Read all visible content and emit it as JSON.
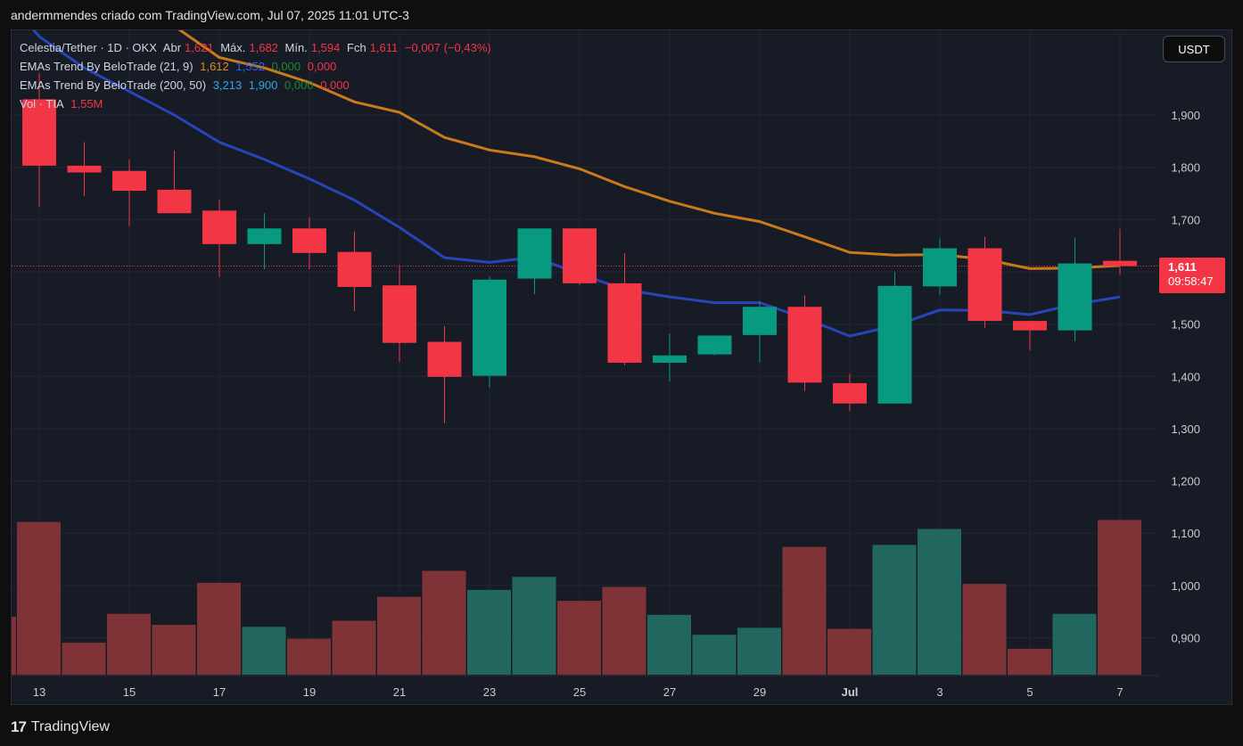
{
  "header": {
    "caption": "andermmendes criado com TradingView.com, Jul 07, 2025 11:01 UTC-3"
  },
  "legend": {
    "symbol": "Celestia/Tether · 1D · OKX",
    "open_label": "Abr",
    "open_value": "1,621",
    "high_label": "Máx.",
    "high_value": "1,682",
    "low_label": "Mín.",
    "low_value": "1,594",
    "close_label": "Fch",
    "close_value": "1,611",
    "change": "−0,007 (−0,43%)",
    "ema1_name": "EMAs Trend By BeloTrade (21, 9)",
    "ema1_v1": "1,612",
    "ema1_v2": "1,552",
    "ema1_v3": "0,000",
    "ema1_v4": "0,000",
    "ema2_name": "EMAs Trend By BeloTrade (200, 50)",
    "ema2_v1": "3,213",
    "ema2_v2": "1,900",
    "ema2_v3": "0,000",
    "ema2_v4": "0,000",
    "vol_name": "Vol · TIA",
    "vol_value": "1,55M"
  },
  "currency_button": "USDT",
  "last_price": {
    "price": "1,611",
    "countdown": "09:58:47"
  },
  "footer": {
    "brand": "TradingView",
    "mark": "17"
  },
  "colors": {
    "up": "#089981",
    "down": "#f23645",
    "vol_up": "#22675f",
    "vol_down": "#7f3337",
    "ema_orange": "#c97a1a",
    "ema_blue": "#2745b8"
  },
  "chart_data": {
    "type": "candlestick",
    "y_ticks": [
      "1,300",
      "1,400",
      "1,500",
      "1,600",
      "1,700",
      "1,800",
      "1,900",
      "1,000",
      "1,100",
      "1,200"
    ],
    "price_ticks": [
      {
        "label": "1,900",
        "value": 1.9
      },
      {
        "label": "1,800",
        "value": 1.8
      },
      {
        "label": "1,700",
        "value": 1.7
      },
      {
        "label": "1,600",
        "value": 1.6
      },
      {
        "label": "1,500",
        "value": 1.5
      },
      {
        "label": "1,400",
        "value": 1.4
      },
      {
        "label": "1,300",
        "value": 1.3
      },
      {
        "label": "1,200",
        "value": 1.2
      },
      {
        "label": "1,100",
        "value": 1.1
      },
      {
        "label": "1,000",
        "value": 1.0
      },
      {
        "label": "0,900",
        "value": 0.9
      }
    ],
    "x_tick_labels": [
      "13",
      "15",
      "17",
      "19",
      "21",
      "23",
      "25",
      "27",
      "29",
      "Jul",
      "3",
      "5",
      "7"
    ],
    "x_tick_index": [
      0,
      2,
      4,
      6,
      8,
      10,
      12,
      14,
      16,
      18,
      20,
      22,
      24
    ],
    "candles": [
      {
        "o": 1.93,
        "h": 1.98,
        "l": 1.725,
        "c": 1.803
      },
      {
        "o": 1.803,
        "h": 1.848,
        "l": 1.745,
        "c": 1.79
      },
      {
        "o": 1.793,
        "h": 1.815,
        "l": 1.687,
        "c": 1.755
      },
      {
        "o": 1.757,
        "h": 1.832,
        "l": 1.73,
        "c": 1.712
      },
      {
        "o": 1.717,
        "h": 1.738,
        "l": 1.59,
        "c": 1.653
      },
      {
        "o": 1.653,
        "h": 1.712,
        "l": 1.605,
        "c": 1.683
      },
      {
        "o": 1.683,
        "h": 1.705,
        "l": 1.605,
        "c": 1.636
      },
      {
        "o": 1.638,
        "h": 1.677,
        "l": 1.525,
        "c": 1.571
      },
      {
        "o": 1.574,
        "h": 1.613,
        "l": 1.427,
        "c": 1.464
      },
      {
        "o": 1.466,
        "h": 1.496,
        "l": 1.31,
        "c": 1.399
      },
      {
        "o": 1.401,
        "h": 1.591,
        "l": 1.378,
        "c": 1.585
      },
      {
        "o": 1.587,
        "h": 1.682,
        "l": 1.557,
        "c": 1.683
      },
      {
        "o": 1.683,
        "h": 1.682,
        "l": 1.575,
        "c": 1.578
      },
      {
        "o": 1.578,
        "h": 1.635,
        "l": 1.421,
        "c": 1.426
      },
      {
        "o": 1.426,
        "h": 1.482,
        "l": 1.39,
        "c": 1.44
      },
      {
        "o": 1.442,
        "h": 1.478,
        "l": 1.44,
        "c": 1.478
      },
      {
        "o": 1.479,
        "h": 1.544,
        "l": 1.427,
        "c": 1.533
      },
      {
        "o": 1.533,
        "h": 1.555,
        "l": 1.372,
        "c": 1.388
      },
      {
        "o": 1.387,
        "h": 1.405,
        "l": 1.333,
        "c": 1.348
      },
      {
        "o": 1.348,
        "h": 1.6,
        "l": 1.348,
        "c": 1.573
      },
      {
        "o": 1.572,
        "h": 1.664,
        "l": 1.556,
        "c": 1.645
      },
      {
        "o": 1.645,
        "h": 1.667,
        "l": 1.493,
        "c": 1.506
      },
      {
        "o": 1.506,
        "h": 1.502,
        "l": 1.45,
        "c": 1.488
      },
      {
        "o": 1.488,
        "h": 1.665,
        "l": 1.467,
        "c": 1.616
      },
      {
        "o": 1.621,
        "h": 1.682,
        "l": 1.594,
        "c": 1.611
      }
    ],
    "volume_values_m": [
      1.53,
      0.32,
      0.61,
      0.5,
      0.92,
      0.48,
      0.36,
      0.54,
      0.78,
      1.04,
      0.85,
      0.98,
      0.74,
      0.88,
      0.6,
      0.4,
      0.47,
      1.28,
      0.46,
      1.3,
      1.46,
      0.91,
      0.26,
      0.61,
      1.55
    ],
    "volume_up": [
      false,
      false,
      false,
      false,
      false,
      true,
      false,
      false,
      false,
      false,
      true,
      true,
      false,
      false,
      true,
      true,
      true,
      false,
      false,
      true,
      true,
      false,
      false,
      true,
      false
    ],
    "ema_fast_values": [
      2.05,
      1.99,
      1.945,
      1.9,
      1.848,
      1.815,
      1.778,
      1.737,
      1.685,
      1.627,
      1.618,
      1.628,
      1.596,
      1.566,
      1.552,
      1.541,
      1.541,
      1.511,
      1.477,
      1.497,
      1.527,
      1.526,
      1.518,
      1.538,
      1.552
    ],
    "ema_slow_values": [
      2.25,
      2.19,
      2.13,
      2.07,
      2.01,
      1.99,
      1.962,
      1.925,
      1.905,
      1.857,
      1.833,
      1.82,
      1.797,
      1.763,
      1.735,
      1.712,
      1.696,
      1.667,
      1.637,
      1.632,
      1.633,
      1.624,
      1.606,
      1.607,
      1.612
    ],
    "last_price_line": 1.611,
    "ylim": [
      1.17,
      2.0
    ]
  }
}
